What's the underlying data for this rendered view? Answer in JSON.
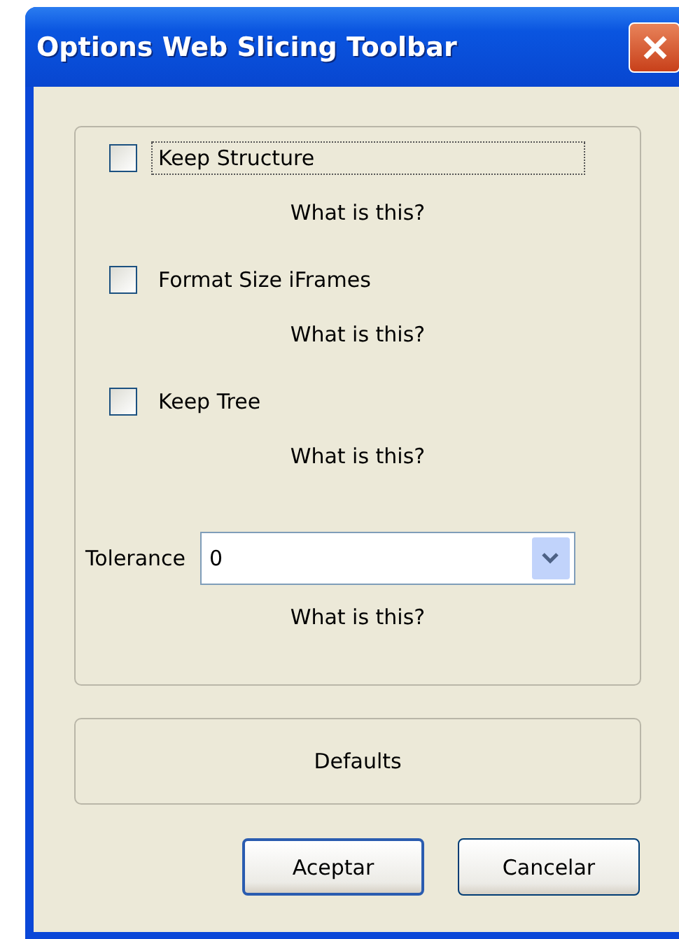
{
  "window": {
    "title": "Options Web Slicing Toolbar"
  },
  "options": [
    {
      "label": "Keep Structure",
      "checked": false,
      "focused": true,
      "help": "What is this?"
    },
    {
      "label": "Format Size iFrames",
      "checked": false,
      "focused": false,
      "help": "What is this?"
    },
    {
      "label": "Keep Tree",
      "checked": false,
      "focused": false,
      "help": "What is this?"
    }
  ],
  "tolerance": {
    "label": "Tolerance",
    "value": "0",
    "help": "What is this?"
  },
  "defaults_button": "Defaults",
  "buttons": [
    {
      "label": "Aceptar",
      "default": true
    },
    {
      "label": "Cancelar",
      "default": false
    }
  ]
}
